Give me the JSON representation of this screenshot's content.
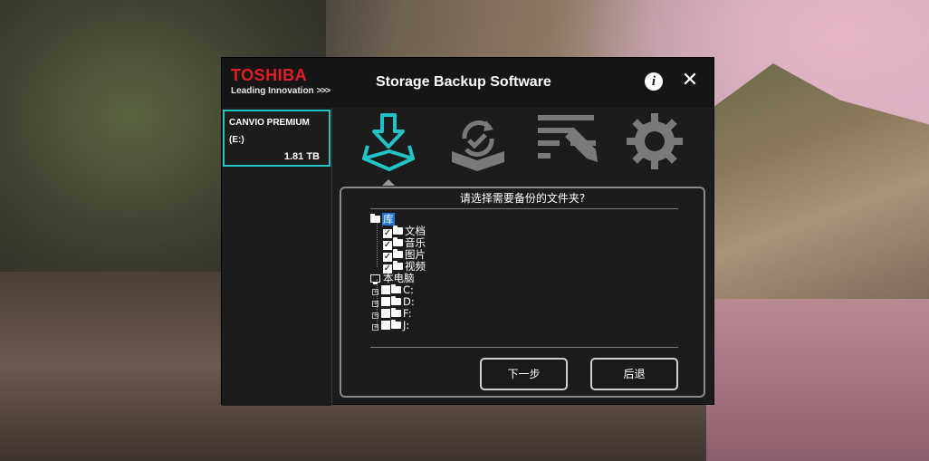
{
  "app": {
    "brand": "TOSHIBA",
    "brand_tagline": "Leading Innovation",
    "brand_chevrons": ">>>",
    "title": "Storage Backup Software",
    "info_label": "i",
    "close_label": "✕"
  },
  "device": {
    "name": "CANVIO PREMIUM",
    "letter": "(E:)",
    "size": "1.81 TB"
  },
  "toolbar": {
    "items": [
      {
        "icon": "backup-download-icon",
        "active": true,
        "color": "#21c3c6"
      },
      {
        "icon": "restore-sync-icon",
        "active": false,
        "color": "#7a7a7a"
      },
      {
        "icon": "edit-list-icon",
        "active": false,
        "color": "#7a7a7a"
      },
      {
        "icon": "gear-icon",
        "active": false,
        "color": "#7a7a7a"
      }
    ]
  },
  "panel": {
    "prompt": "请选择需要备份的文件夹?",
    "tree": {
      "library": {
        "label": "库",
        "selected": true,
        "children": [
          {
            "label": "文档",
            "checked": true
          },
          {
            "label": "音乐",
            "checked": true
          },
          {
            "label": "图片",
            "checked": true
          },
          {
            "label": "视频",
            "checked": true
          }
        ]
      },
      "computer": {
        "label": "本电脑",
        "children": [
          {
            "label": "C:",
            "checked": false,
            "expander": "+"
          },
          {
            "label": "D:",
            "checked": false,
            "expander": "+"
          },
          {
            "label": "F:",
            "checked": false,
            "expander": "+"
          },
          {
            "label": "J:",
            "checked": false,
            "expander": "+"
          }
        ]
      }
    },
    "next_button": "下一步",
    "back_button": "后退"
  },
  "colors": {
    "accent": "#21c3c6",
    "brand_red": "#e41e26",
    "selection": "#1e74d6"
  }
}
